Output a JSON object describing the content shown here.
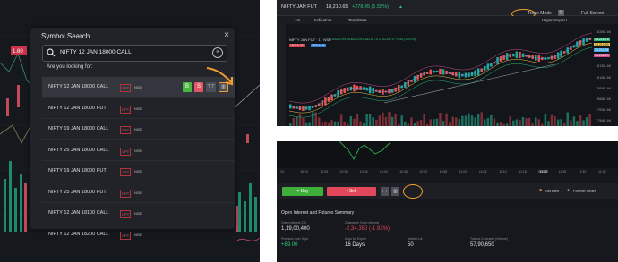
{
  "symbol_search": {
    "title": "Symbol Search",
    "close": "×",
    "query": "NIFTY 12 JAN 18000 CALL",
    "clear": "×",
    "prompt": "Are you looking for:",
    "results": [
      {
        "name": "NIFTY 12 JAN 18000 CALL",
        "type": "OPT",
        "exchange": "NSE"
      },
      {
        "name": "NIFTY 12 JAN 18000 PUT",
        "type": "OPT",
        "exchange": "NSE"
      },
      {
        "name": "NIFTY 19 JAN 18000 CALL",
        "type": "OPT",
        "exchange": "NSE"
      },
      {
        "name": "NIFTY 25 JAN 18000 CALL",
        "type": "OPT",
        "exchange": "NSE"
      },
      {
        "name": "NIFTY 19 JAN 18000 PUT",
        "type": "OPT",
        "exchange": "NSE"
      },
      {
        "name": "NIFTY 25 JAN 18000 PUT",
        "type": "OPT",
        "exchange": "NSE"
      },
      {
        "name": "NIFTY 12 JAN 18100 CALL",
        "type": "OPT",
        "exchange": "NSE"
      },
      {
        "name": "NIFTY 12 JAN 18200 CALL",
        "type": "OPT",
        "exchange": "NSE"
      }
    ],
    "buy_label": "B",
    "sell_label": "S",
    "left_price_badge": "1.60"
  },
  "top_chart": {
    "symbol": "NIFTY JAN FUT",
    "price": "18,210.65",
    "change": "+278.45 (1.55%)",
    "trade_mode": "Trade Mode",
    "full_screen": "Full Screen",
    "interval": "1m",
    "indicators": "Indicators",
    "templates": "Templates",
    "layout_name": "Vagan Super I...",
    "legend_symbol": "NIFTY JAN FUT · 1 · NSE",
    "ohlc": "O18220.95 H18220.95 L18216.75 C18216.75 +1.45 (-0.01%)",
    "bid": "18215.40",
    "ask": "18216.55",
    "y_ticks": [
      "18260.00",
      "18200.00",
      "18150.00",
      "18100.00",
      "18050.00",
      "18000.00",
      "17950.00",
      "17900.00",
      "17850.00"
    ],
    "price_tags": [
      "18,216.75",
      "18,212.99",
      "18,211.09",
      "18,208.70"
    ],
    "colors": {
      "up": "#26a69a",
      "down": "#ef5350",
      "accent": "#f39c2f"
    }
  },
  "bottom_panel": {
    "x_ticks": [
      "10",
      "10:20",
      "10:25",
      "10:30",
      "10:35",
      "10:40",
      "10:45",
      "10:50",
      "10:55",
      "11:00",
      "11:05",
      "11:10",
      "11:15",
      "11:20",
      "11:25",
      "11:30",
      "11:35"
    ],
    "buy_button": "+ Buy",
    "sell_button": "- Sell",
    "set_alert": "Set Alert",
    "forever_order": "Forever Order",
    "oi_title": "Open Interest and Futures Summary",
    "stats": [
      {
        "label": "Open Interest (OI)",
        "value": "1,19,00,400"
      },
      {
        "label": "Change in Open Interest",
        "value": "-2,34,350 (-1.93%)"
      },
      {
        "label": "Premium over Spot",
        "value": "+89.00"
      },
      {
        "label": "Days for Expiry",
        "value": "16 Days"
      },
      {
        "label": "Market Lot",
        "value": "50"
      },
      {
        "label": "Traded Contracts (Volume)",
        "value": "57,90,650"
      }
    ]
  }
}
